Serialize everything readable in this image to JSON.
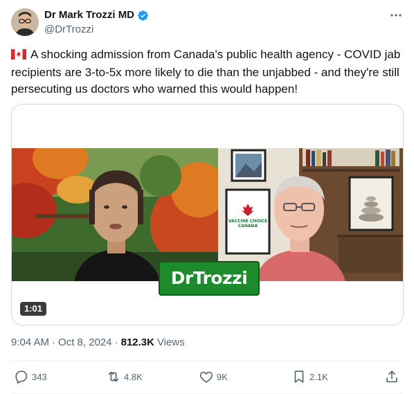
{
  "author": {
    "display_name": "Dr Mark Trozzi MD",
    "handle": "@DrTrozzi"
  },
  "tweet": {
    "text": "A shocking admission from Canada's public health agency - COVID jab recipients are 3-to-5x more likely to die than the unjabbed - and they're still persecuting us doctors who warned this would happen!",
    "flag_icon": "canada-flag-icon"
  },
  "media": {
    "duration": "1:01",
    "watermark": "DrTrozzi",
    "poster_text": "VACCINE CHOICE CANADA"
  },
  "meta": {
    "time": "9:04 AM",
    "separator": "·",
    "date": "Oct 8, 2024",
    "views_count": "812.3K",
    "views_label": "Views"
  },
  "actions": {
    "replies": "343",
    "reposts": "4.8K",
    "likes": "9K",
    "bookmarks": "2.1K"
  },
  "colors": {
    "verified": "#1d9bf0",
    "secondary_text": "#536471",
    "watermark_green": "#1d8a2c"
  }
}
